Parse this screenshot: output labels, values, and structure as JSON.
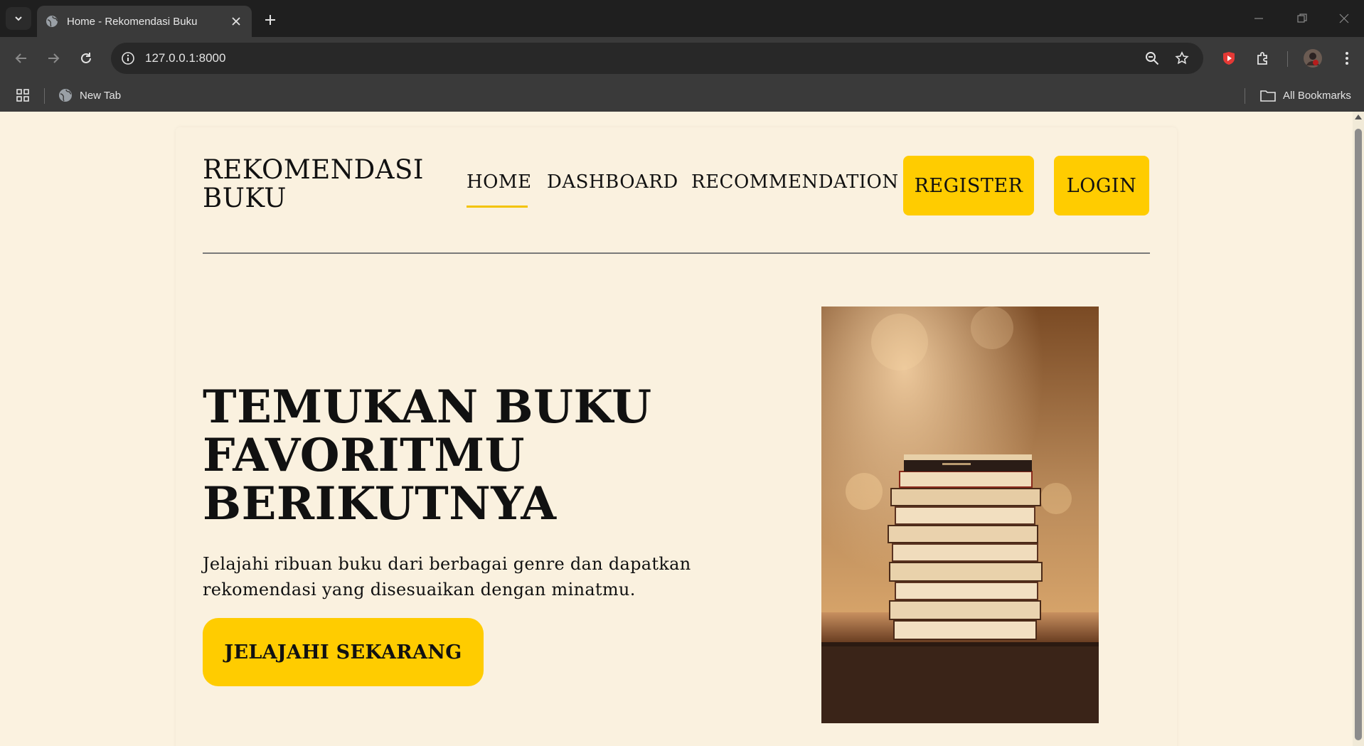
{
  "browser": {
    "tab_title": "Home - Rekomendasi Buku",
    "url": "127.0.0.1:8000",
    "bookmarks": [
      {
        "label": "New Tab"
      },
      {
        "label": "All Bookmarks"
      }
    ]
  },
  "site": {
    "brand": "REKOMENDASI BUKU",
    "nav": [
      {
        "label": "HOME",
        "active": true
      },
      {
        "label": "DASHBOARD",
        "active": false
      },
      {
        "label": "RECOMMENDATION",
        "active": false
      }
    ],
    "register_label": "REGISTER",
    "login_label": "LOGIN"
  },
  "hero": {
    "title": "TEMUKAN BUKU FAVORITMU BERIKUTNYA",
    "description": "Jelajahi ribuan buku dari berbagai genre dan dapatkan rekomendasi yang disesuaikan dengan minatmu.",
    "cta_label": "JELAJAHI SEKARANG",
    "image_subject": "stack-of-books-photo"
  },
  "colors": {
    "accent": "#ffcc00",
    "page_bg": "#fbf2e0",
    "text": "#111111",
    "chrome_dark": "#1f1f1f",
    "chrome_toolbar": "#3a3a3a"
  }
}
